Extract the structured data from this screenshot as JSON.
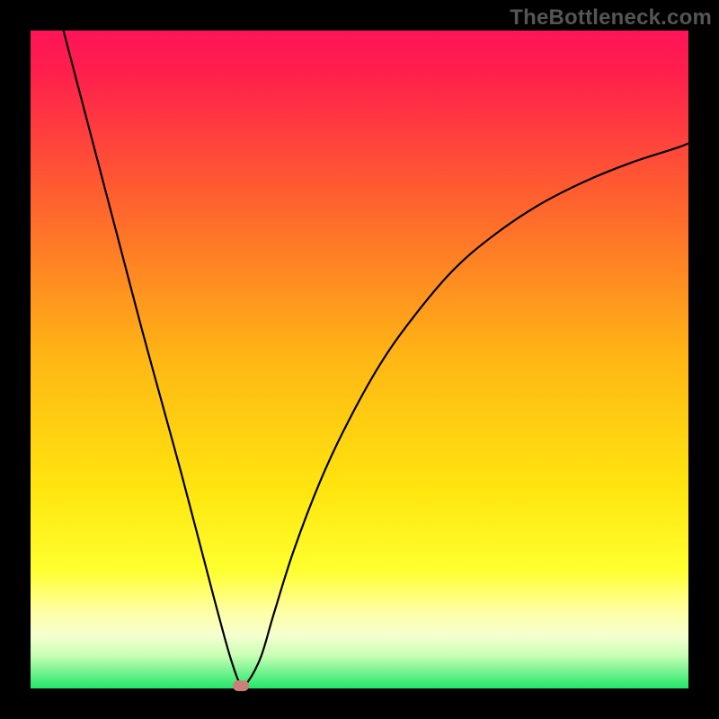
{
  "watermark": "TheBottleneck.com",
  "chart_data": {
    "type": "line",
    "title": "",
    "xlabel": "",
    "ylabel": "",
    "xlim": [
      0,
      100
    ],
    "ylim": [
      0,
      105
    ],
    "grid": false,
    "legend": false,
    "gradient_stops": [
      {
        "pct": 0,
        "color": "#ff1458"
      },
      {
        "pct": 6,
        "color": "#ff1e4d"
      },
      {
        "pct": 25,
        "color": "#ff5f2f"
      },
      {
        "pct": 50,
        "color": "#ffb714"
      },
      {
        "pct": 70,
        "color": "#ffe60f"
      },
      {
        "pct": 82,
        "color": "#ffff2f"
      },
      {
        "pct": 88,
        "color": "#ffffa0"
      },
      {
        "pct": 92,
        "color": "#f5ffd0"
      },
      {
        "pct": 95,
        "color": "#c8ffb4"
      },
      {
        "pct": 100,
        "color": "#22e66a"
      }
    ],
    "series": [
      {
        "name": "bottleneck-curve",
        "color": "#000000",
        "width": 2.2,
        "x": [
          5,
          8,
          11,
          14,
          17,
          20,
          23,
          26,
          28.5,
          30.5,
          32,
          33,
          35,
          37,
          40,
          44,
          48,
          53,
          58,
          64,
          70,
          77,
          84,
          91,
          98,
          100
        ],
        "y": [
          105,
          93,
          81,
          69,
          57,
          45.5,
          34,
          22,
          12,
          4.5,
          0.5,
          1,
          5,
          12,
          22,
          33,
          42,
          51.5,
          59,
          66.5,
          72,
          77,
          80.8,
          83.8,
          86.2,
          87
        ]
      }
    ],
    "marker": {
      "x": 32,
      "y": 0.5,
      "color": "#cc7f78"
    }
  }
}
